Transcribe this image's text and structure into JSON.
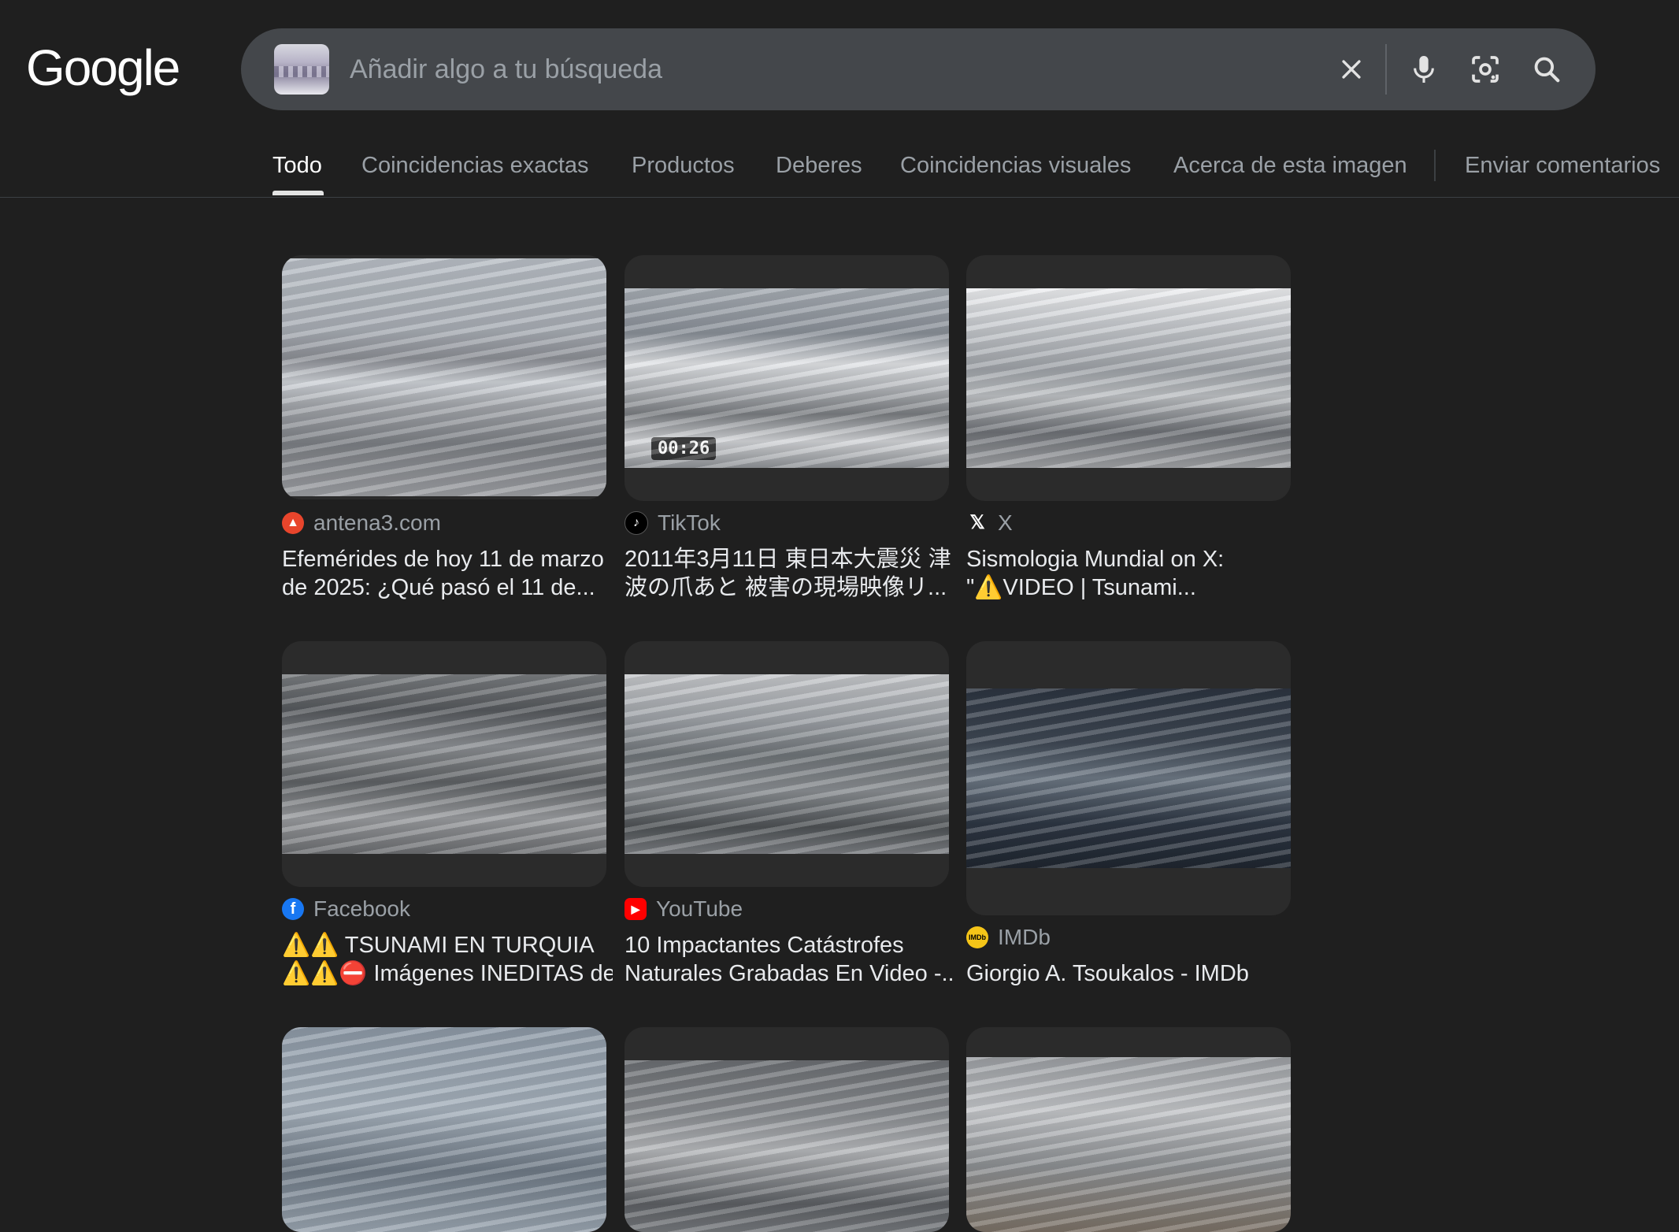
{
  "header": {
    "logo": "Google",
    "search_placeholder": "Añadir algo a tu búsqueda"
  },
  "icons": {
    "clear": "close-icon",
    "voice": "microphone-icon",
    "lens": "lens-icon",
    "search": "search-icon"
  },
  "tabs": [
    {
      "label": "Todo",
      "active": true
    },
    {
      "label": "Coincidencias exactas"
    },
    {
      "label": "Productos"
    },
    {
      "label": "Deberes"
    },
    {
      "label": "Coincidencias visuales"
    },
    {
      "label": "Acerca de esta imagen"
    },
    {
      "label": "Enviar comentarios"
    }
  ],
  "results": [
    {
      "source": "antena3.com",
      "title_line1": "Efemérides de hoy 11 de marzo",
      "title_line2": "de 2025: ¿Qué pasó el 11 de..."
    },
    {
      "source": "TikTok",
      "duration": "00:26",
      "title_line1": "2011年3月11日 東日本大震災 津",
      "title_line2": "波の爪あと 被害の現場映像リ..."
    },
    {
      "source": "X",
      "title_line1": "Sismologia Mundial on X:",
      "title_line2": "\"⚠️VIDEO | Tsunami..."
    },
    {
      "source": "Facebook",
      "title_line1": "⚠️⚠️ TSUNAMI EN TURQUIA",
      "title_line2": "⚠️⚠️⛔ Imágenes INEDITAS del..."
    },
    {
      "source": "YouTube",
      "title_line1": "10 Impactantes Catástrofes",
      "title_line2": "Naturales Grabadas En Video -..."
    },
    {
      "source": "IMDb",
      "title_line1": "Giorgio A. Tsoukalos - IMDb"
    }
  ],
  "colors": {
    "background": "#1f1f1f",
    "search_bar": "#44474b",
    "muted_text": "#9aa0a6",
    "title_text": "#e8eaed"
  }
}
